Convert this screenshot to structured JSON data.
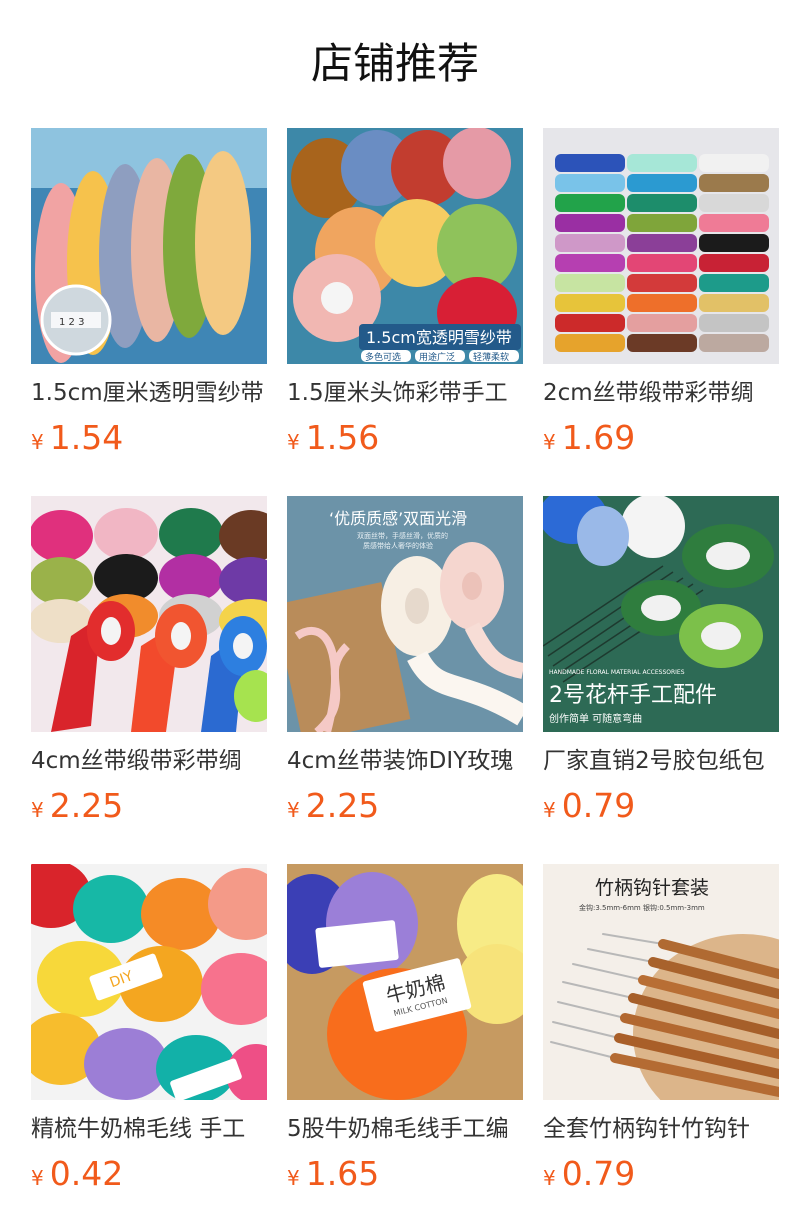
{
  "section": {
    "title": "店铺推荐"
  },
  "colors": {
    "price": "#f15a1b",
    "text": "#333333"
  },
  "products": [
    {
      "name": "1.5cm厘米透明雪纱带",
      "currency": "¥",
      "price": "1.54",
      "image_text": {
        "ruler_marks": "1 2 3"
      }
    },
    {
      "name": "1.5厘米头饰彩带手工",
      "currency": "¥",
      "price": "1.56",
      "image_text": {
        "banner": "1.5cm宽透明雪纱带",
        "tags": [
          "多色可选",
          "用途广泛",
          "轻薄柔软"
        ]
      }
    },
    {
      "name": "2cm丝带缎带彩带绸",
      "currency": "¥",
      "price": "1.69",
      "image_text": {}
    },
    {
      "name": "4cm丝带缎带彩带绸",
      "currency": "¥",
      "price": "2.25",
      "image_text": {}
    },
    {
      "name": "4cm丝带装饰DIY玫瑰",
      "currency": "¥",
      "price": "2.25",
      "image_text": {
        "headline": "‘优质质感’双面光滑",
        "subline1": "双面丝带，手感丝滑，优质的",
        "subline2": "质感带给人奢华的体验"
      }
    },
    {
      "name": "厂家直销2号胶包纸包",
      "currency": "¥",
      "price": "0.79",
      "image_text": {
        "small": "HANDMADE FLORAL MATERIAL ACCESSORIES",
        "headline": "2号花杆手工配件",
        "sub": "创作简单 可随意弯曲"
      }
    },
    {
      "name": "精梳牛奶棉毛线 手工",
      "currency": "¥",
      "price": "0.42",
      "image_text": {
        "label": "DIY"
      }
    },
    {
      "name": "5股牛奶棉毛线手工编",
      "currency": "¥",
      "price": "1.65",
      "image_text": {
        "label": "牛奶棉",
        "label_en": "MILK COTTON"
      }
    },
    {
      "name": "全套竹柄钩针竹钩针",
      "currency": "¥",
      "price": "0.79",
      "image_text": {
        "headline": "竹柄钩针套装",
        "spec": "金钩:3.5mm-6mm   银钩:0.5mm-3mm"
      }
    }
  ]
}
